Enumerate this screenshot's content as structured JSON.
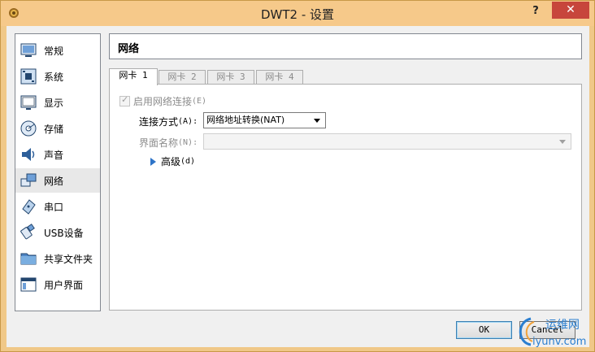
{
  "window": {
    "title": "DWT2 - 设置",
    "help_label": "?",
    "close_label": "✕"
  },
  "sidebar": {
    "items": [
      {
        "label": "常规",
        "icon": "general-icon"
      },
      {
        "label": "系统",
        "icon": "system-icon"
      },
      {
        "label": "显示",
        "icon": "display-icon"
      },
      {
        "label": "存储",
        "icon": "storage-icon"
      },
      {
        "label": "声音",
        "icon": "audio-icon"
      },
      {
        "label": "网络",
        "icon": "network-icon",
        "selected": true
      },
      {
        "label": "串口",
        "icon": "serial-port-icon"
      },
      {
        "label": "USB设备",
        "icon": "usb-icon"
      },
      {
        "label": "共享文件夹",
        "icon": "shared-folder-icon"
      },
      {
        "label": "用户界面",
        "icon": "user-interface-icon"
      }
    ]
  },
  "section": {
    "title": "网络"
  },
  "tabs": [
    {
      "label": "网卡 1",
      "active": true
    },
    {
      "label": "网卡 2"
    },
    {
      "label": "网卡 3"
    },
    {
      "label": "网卡 4"
    }
  ],
  "adapter": {
    "enable_label": "启用网络连接",
    "enable_mnemonic": "(E)",
    "enabled": true,
    "attached_label": "连接方式",
    "attached_mnemonic": "(A):",
    "attached_value": "网络地址转换(NAT)",
    "name_label": "界面名称",
    "name_mnemonic": "(N):",
    "name_value": "",
    "advanced_label": "高级",
    "advanced_mnemonic": "(d)"
  },
  "buttons": {
    "ok": "OK",
    "cancel": "Cancel"
  },
  "watermark": {
    "line1": "运维网",
    "line2": "iyunv.com"
  },
  "colors": {
    "titlebar": "#f6c98a",
    "close": "#c7463c",
    "accent": "#2e74c8"
  }
}
